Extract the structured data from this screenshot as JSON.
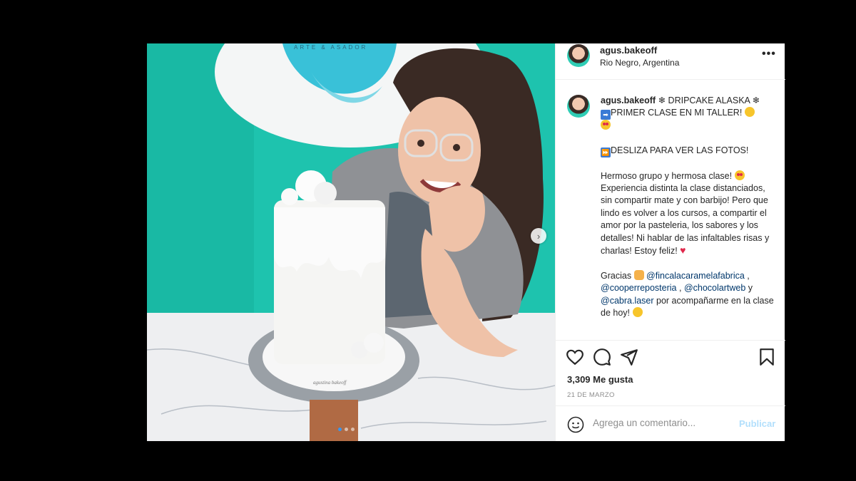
{
  "post": {
    "username": "agus.bakeoff",
    "location": "Rio Negro, Argentina",
    "caption": {
      "title": "❄ DRIPCAKE ALASKA ❄",
      "line2": "PRIMER CLASE EN MI TALLER!",
      "swipe": "DESLIZA PARA VER LAS FOTOS!",
      "body": "Hermoso grupo y hermosa clase!",
      "body2": "Experiencia distinta la clase distanciados, sin compartir mate y con barbijo! Pero que lindo es volver a los cursos, a compartir el amor por la pasteleria, los sabores y los detalles! Ni hablar de las infaltables risas y charlas! Estoy feliz!",
      "thanks": "Gracias",
      "mention1": "@fincalacaramelafabrica",
      "sep1": ",",
      "mention2": "@cooperreposteria",
      "sep2": ",",
      "mention3": "@chocolartweb",
      "conj": "y",
      "mention4": "@cabra.laser",
      "closing": "por acompañarme en la clase de hoy!"
    },
    "likes": "3,309 Me gusta",
    "date": "21 DE MARZO",
    "comment_placeholder": "Agrega un comentario...",
    "publish_label": "Publicar"
  },
  "photo": {
    "sign_text": "ARTE & ASADOR",
    "board_text": "agustina bakeoff"
  },
  "icons": {
    "more": "more-options-icon",
    "like": "heart-icon",
    "comment": "comment-icon",
    "share": "share-icon",
    "save": "bookmark-icon",
    "emoji": "emoji-icon",
    "next": "chevron-right-icon"
  },
  "colors": {
    "wall": "#20c4b0",
    "link": "#00376b",
    "publish_disabled": "#b2dffc",
    "carousel_active": "#3897f0"
  }
}
